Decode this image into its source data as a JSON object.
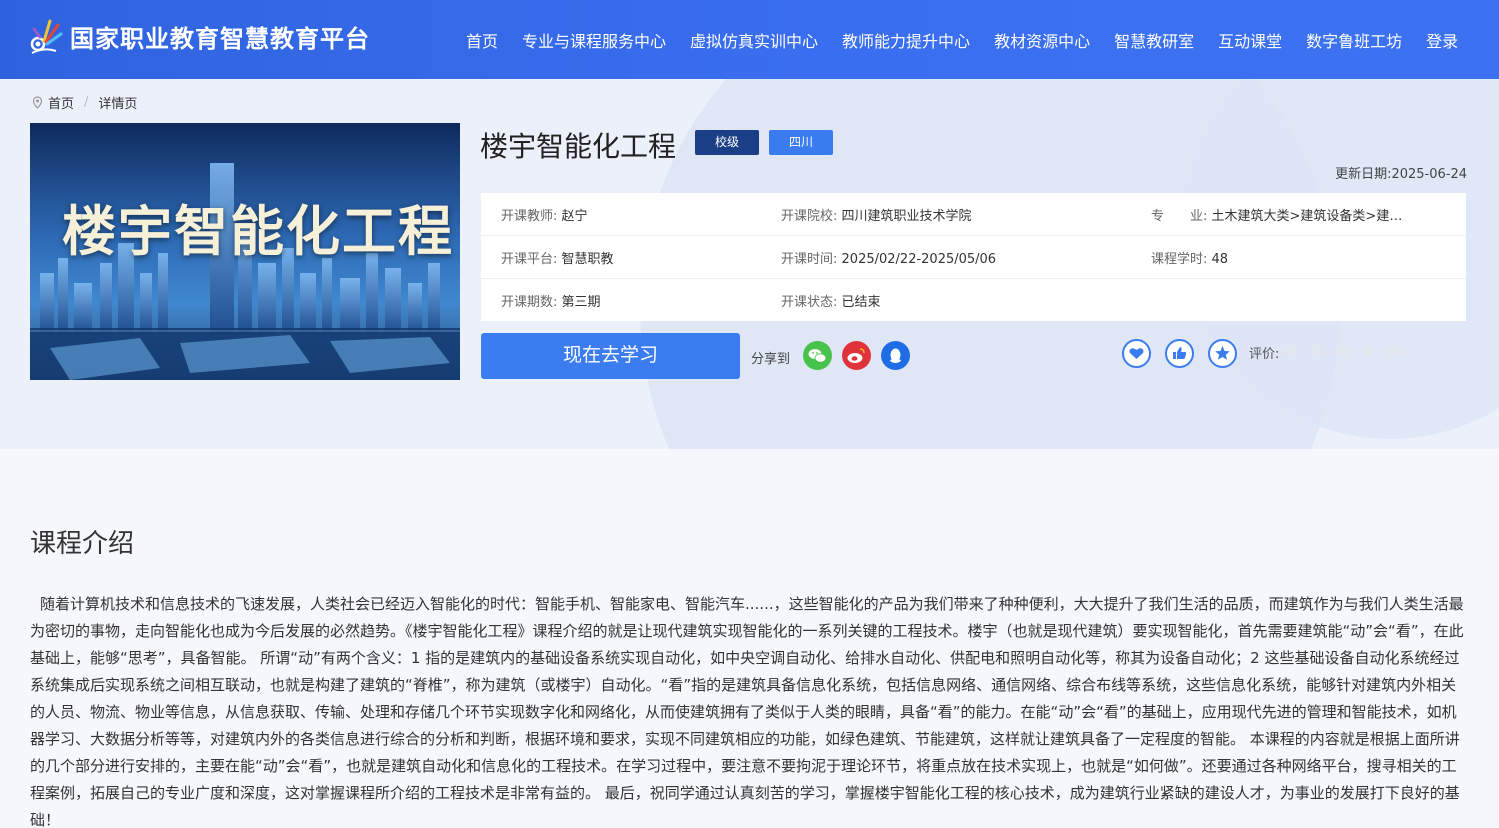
{
  "header": {
    "site_title": "国家职业教育智慧教育平台",
    "nav": [
      "首页",
      "专业与课程服务中心",
      "虚拟仿真实训中心",
      "教师能力提升中心",
      "教材资源中心",
      "智慧教研室",
      "互动课堂",
      "数字鲁班工坊",
      "登录"
    ]
  },
  "breadcrumb": {
    "home": "首页",
    "current": "详情页",
    "separator": "/"
  },
  "cover": {
    "title": "楼宇智能化工程"
  },
  "course": {
    "title": "楼宇智能化工程",
    "tag_level": "校级",
    "tag_region": "四川",
    "update_date": "更新日期:2025-06-24",
    "info": {
      "teacher_label": "开课教师:",
      "teacher": "赵宁",
      "school_label": "开课院校:",
      "school": "四川建筑职业技术学院",
      "major_label": "专　　业:",
      "major": "土木建筑大类>建筑设备类>建…",
      "platform_label": "开课平台:",
      "platform": "智慧职教",
      "time_label": "开课时间:",
      "time": "2025/02/22-2025/05/06",
      "hours_label": "课程学时:",
      "hours": "48",
      "term_label": "开课期数:",
      "term": "第三期",
      "status_label": "开课状态:",
      "status": "已结束"
    },
    "study_button": "现在去学习",
    "share_label": "分享到",
    "rating_label": "评价:",
    "rating_value": 0,
    "rating_max": 5
  },
  "intro": {
    "title": "课程介绍",
    "text": "随着计算机技术和信息技术的飞速发展，人类社会已经迈入智能化的时代：智能手机、智能家电、智能汽车......，这些智能化的产品为我们带来了种种便利，大大提升了我们生活的品质，而建筑作为与我们人类生活最为密切的事物，走向智能化也成为今后发展的必然趋势。《楼宇智能化工程》课程介绍的就是让现代建筑实现智能化的一系列关键的工程技术。楼宇（也就是现代建筑）要实现智能化，首先需要建筑能“动”会“看”，在此基础上，能够“思考”，具备智能。 所谓“动”有两个含义：1 指的是建筑内的基础设备系统实现自动化，如中央空调自动化、给排水自动化、供配电和照明自动化等，称其为设备自动化；2 这些基础设备自动化系统经过系统集成后实现系统之间相互联动，也就是构建了建筑的“脊椎”，称为建筑（或楼宇）自动化。“看”指的是建筑具备信息化系统，包括信息网络、通信网络、综合布线等系统，这些信息化系统，能够针对建筑内外相关的人员、物流、物业等信息，从信息获取、传输、处理和存储几个环节实现数字化和网络化，从而使建筑拥有了类似于人类的眼睛，具备“看”的能力。在能“动”会“看”的基础上，应用现代先进的管理和智能技术，如机器学习、大数据分析等等，对建筑内外的各类信息进行综合的分析和判断，根据环境和要求，实现不同建筑相应的功能，如绿色建筑、节能建筑，这样就让建筑具备了一定程度的智能。 本课程的内容就是根据上面所讲的几个部分进行安排的，主要在能“动”会“看”，也就是建筑自动化和信息化的工程技术。在学习过程中，要注意不要拘泥于理论环节，将重点放在技术实现上，也就是“如何做”。还要通过各种网络平台，搜寻相关的工程案例，拓展自己的专业广度和深度，这对掌握课程所介绍的工程技术是非常有益的。 最后，祝同学通过认真刻苦的学习，掌握楼宇智能化工程的核心技术，成为建筑行业紧缺的建设人才，为事业的发展打下良好的基础！"
  },
  "icons": [
    "logo-icon",
    "location-pin-icon",
    "wechat-icon",
    "weibo-icon",
    "qq-icon",
    "heart-icon",
    "thumbs-up-icon",
    "star-icon"
  ],
  "colors": {
    "header_blue": "#3a6ef0",
    "button_blue": "#3b7cf0",
    "tag_dark": "#1b3f86",
    "wechat": "#47c34c",
    "weibo": "#e0323b",
    "qq": "#1f6de4"
  }
}
